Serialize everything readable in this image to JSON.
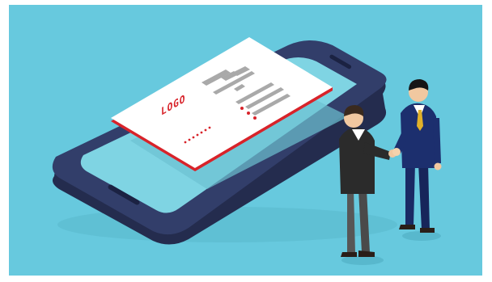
{
  "scene": {
    "background_color": "#67c9de",
    "phone_color": "#2f3a64",
    "phone_screen_color": "#7ed3e2",
    "card_color": "#ffffff",
    "card_accent_color": "#d8232a",
    "business_card": {
      "logo_text": "LOGO"
    },
    "people": [
      {
        "role": "businessman-left",
        "suit_color": "#2b2b2b",
        "trousers_color": "#575757"
      },
      {
        "role": "businessman-right",
        "suit_color": "#1c2f6e",
        "tie_color": "#e0b12a"
      }
    ]
  }
}
